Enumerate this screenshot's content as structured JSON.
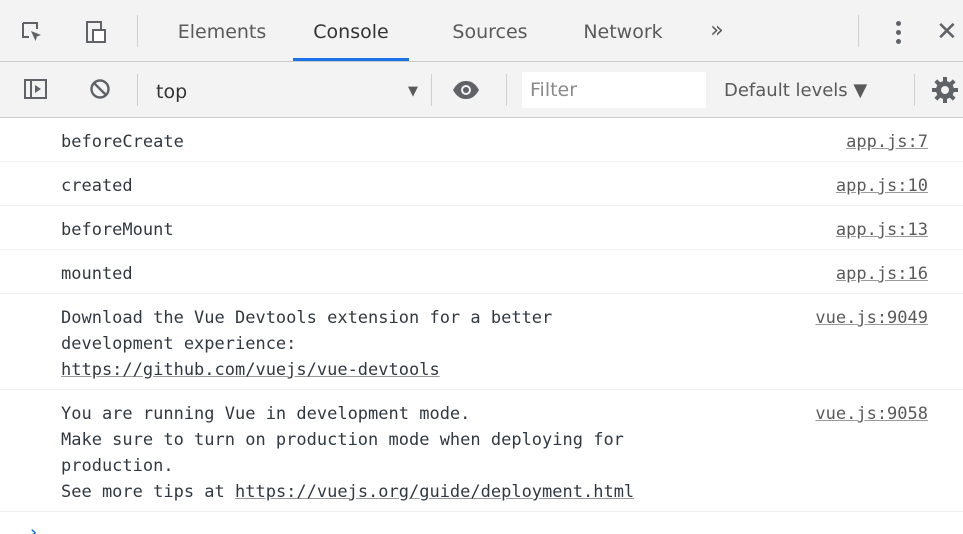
{
  "tabbar": {
    "tabs": [
      {
        "label": "Elements"
      },
      {
        "label": "Console"
      },
      {
        "label": "Sources"
      },
      {
        "label": "Network"
      }
    ],
    "more_label": "»",
    "close_label": "✕"
  },
  "toolbar": {
    "context_label": "top",
    "filter_placeholder": "Filter",
    "levels_label": "Default levels ▼"
  },
  "messages": [
    {
      "text": "beforeCreate",
      "source": "app.js:7"
    },
    {
      "text": "created",
      "source": "app.js:10"
    },
    {
      "text": "beforeMount",
      "source": "app.js:13"
    },
    {
      "text": "mounted",
      "source": "app.js:16"
    },
    {
      "lines": [
        "Download the Vue Devtools extension for a better",
        "development experience:"
      ],
      "link": "https://github.com/vuejs/vue-devtools",
      "source": "vue.js:9049"
    },
    {
      "lines": [
        "You are running Vue in development mode.",
        "Make sure to turn on production mode when deploying for",
        "production."
      ],
      "prefix": "See more tips at ",
      "link": "https://vuejs.org/guide/deployment.html",
      "source": "vue.js:9058"
    }
  ],
  "prompt_symbol": "›",
  "colors": {
    "accent": "#1a73e8",
    "toolbar_bg": "#f3f3f3",
    "border": "#cbcbcb"
  }
}
